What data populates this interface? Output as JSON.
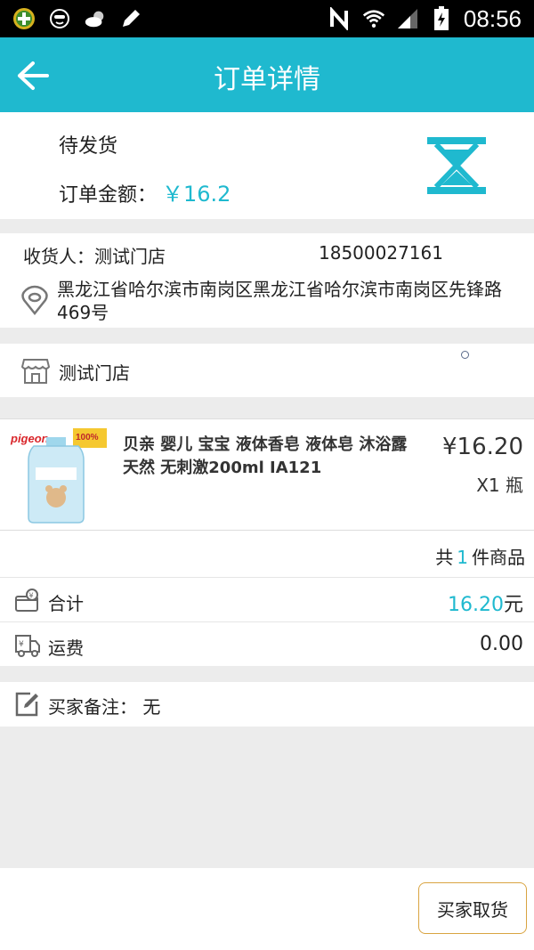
{
  "status_bar": {
    "time": "08:56",
    "icons": [
      "app-plus-icon",
      "face-icon",
      "weather-icon",
      "pen-icon",
      "nfc-icon",
      "wifi-icon",
      "signal-icon",
      "battery-icon"
    ]
  },
  "header": {
    "title": "订单详情"
  },
  "order_status": {
    "status": "待发货",
    "amount_label": "订单金额：",
    "amount_value": "￥16.2"
  },
  "address": {
    "consignee_label": "收货人：",
    "consignee_name": "测试门店",
    "phone": "18500027161",
    "full_address": "黑龙江省哈尔滨市南岗区黑龙江省哈尔滨市南岗区先锋路469号"
  },
  "store": {
    "name": "测试门店"
  },
  "product": {
    "name": "贝亲 婴儿 宝宝 液体香皂 液体皂 沐浴露 天然 无刺激200ml IA121",
    "price": "¥16.20",
    "qty": "X1 瓶",
    "thumb_brand": "pigeon",
    "thumb_badge": "100%"
  },
  "summary": {
    "count_prefix": "共",
    "count": "1",
    "count_suffix": "件商品",
    "total_label": "合计",
    "total_value": "16.20",
    "total_unit": "元",
    "shipping_label": "运费",
    "shipping_value": "0.00"
  },
  "remark": {
    "label": "买家备注：",
    "value": "无"
  },
  "actions": {
    "pickup_label": "买家取货"
  },
  "colors": {
    "accent": "#1fb9cf",
    "button_border": "#d9a441"
  }
}
